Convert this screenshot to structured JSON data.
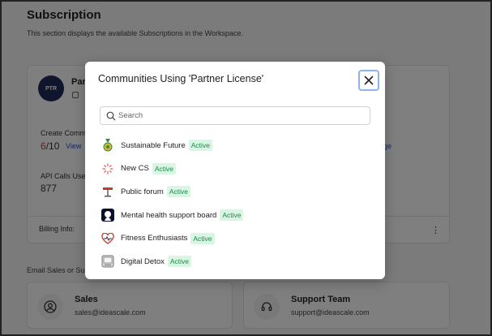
{
  "page": {
    "title": "Subscription",
    "description": "This section displays the available Subscriptions in the Workspace."
  },
  "plan": {
    "logo_text": "PTR",
    "name_visible": "Par",
    "create_label": "Create Comm",
    "create_used": "6",
    "create_total": "/10",
    "view_link": "View",
    "manage_link": "ge",
    "api_label": "API Calls Use",
    "api_value": "877",
    "billing_label": "Billing Info:",
    "more_icon": "vertical-ellipsis-icon"
  },
  "contacts": {
    "label": "Email Sales or Sup",
    "sales": {
      "title": "Sales",
      "email": "sales@ideascale.com",
      "icon": "user-circle-icon"
    },
    "support": {
      "title": "Support Team",
      "email": "support@ideascale.com",
      "icon": "headset-icon"
    }
  },
  "modal": {
    "title": "Communities Using 'Partner License'",
    "close_icon": "close-icon",
    "search_placeholder": "Search",
    "items": [
      {
        "name": "Sustainable Future",
        "status": "Active",
        "icon": "medal-icon"
      },
      {
        "name": "New CS",
        "status": "Active",
        "icon": "spinner-icon"
      },
      {
        "name": "Public forum",
        "status": "Active",
        "icon": "signpost-icon"
      },
      {
        "name": "Mental health support board",
        "status": "Active",
        "icon": "silhouette-icon"
      },
      {
        "name": "Fitness Enthusiasts",
        "status": "Active",
        "icon": "heart-icon"
      },
      {
        "name": "Digital Detox",
        "status": "Active",
        "icon": "device-icon"
      }
    ]
  },
  "colors": {
    "accent": "#2b50c8",
    "active_badge_bg": "#d9f5e3",
    "active_badge_text": "#1f8a4c",
    "close_border": "#8fb2e8"
  }
}
